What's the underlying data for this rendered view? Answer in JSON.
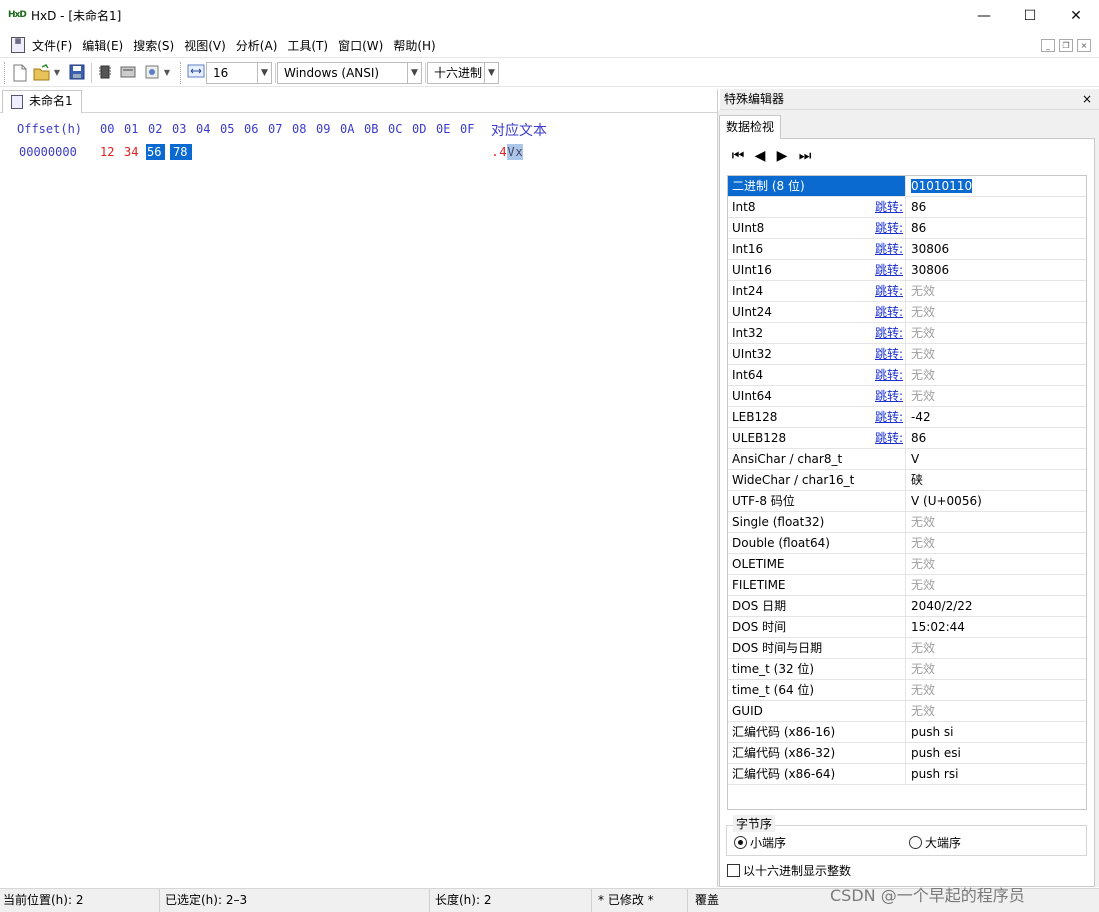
{
  "window": {
    "app_icon_text": "HxD",
    "title": "HxD - [未命名1]",
    "minimize": "—",
    "maximize": "☐",
    "close": "✕"
  },
  "menu": {
    "items": [
      "文件(F)",
      "编辑(E)",
      "搜索(S)",
      "视图(V)",
      "分析(A)",
      "工具(T)",
      "窗口(W)",
      "帮助(H)"
    ],
    "mdi_minimize": "_",
    "mdi_restore": "❐",
    "mdi_close": "×"
  },
  "toolbar": {
    "bytes_per_row": "16",
    "charset": "Windows (ANSI)",
    "offset_base": "十六进制",
    "icons": [
      "new-file-icon",
      "open-file-icon",
      "save-icon",
      "chip-icon",
      "disk-icon",
      "ram-icon",
      "width-icon"
    ]
  },
  "document": {
    "tab_label": "未命名1",
    "offset_header": "Offset(h)",
    "columns": [
      "00",
      "01",
      "02",
      "03",
      "04",
      "05",
      "06",
      "07",
      "08",
      "09",
      "0A",
      "0B",
      "0C",
      "0D",
      "0E",
      "0F"
    ],
    "text_header": "对应文本",
    "row_offset": "00000000",
    "bytes": [
      "12",
      "34",
      "56",
      "78"
    ],
    "selected_bytes": [
      2,
      3
    ],
    "ascii": [
      ".",
      "4",
      "V",
      "x"
    ]
  },
  "inspector": {
    "panel_title": "特殊编辑器",
    "close": "×",
    "tab_label": "数据检视",
    "nav": [
      "⏮",
      "◀",
      "▶",
      "⏭"
    ],
    "jump_label": "跳转:",
    "rows": [
      {
        "name": "二进制 (8 位)",
        "value": "01010110",
        "jump": false,
        "invalid": false,
        "selected": true
      },
      {
        "name": "Int8",
        "value": "86",
        "jump": true,
        "invalid": false
      },
      {
        "name": "UInt8",
        "value": "86",
        "jump": true,
        "invalid": false
      },
      {
        "name": "Int16",
        "value": "30806",
        "jump": true,
        "invalid": false
      },
      {
        "name": "UInt16",
        "value": "30806",
        "jump": true,
        "invalid": false
      },
      {
        "name": "Int24",
        "value": "无效",
        "jump": true,
        "invalid": true
      },
      {
        "name": "UInt24",
        "value": "无效",
        "jump": true,
        "invalid": true
      },
      {
        "name": "Int32",
        "value": "无效",
        "jump": true,
        "invalid": true
      },
      {
        "name": "UInt32",
        "value": "无效",
        "jump": true,
        "invalid": true
      },
      {
        "name": "Int64",
        "value": "无效",
        "jump": true,
        "invalid": true
      },
      {
        "name": "UInt64",
        "value": "无效",
        "jump": true,
        "invalid": true
      },
      {
        "name": "LEB128",
        "value": "-42",
        "jump": true,
        "invalid": false
      },
      {
        "name": "ULEB128",
        "value": "86",
        "jump": true,
        "invalid": false
      },
      {
        "name": "AnsiChar / char8_t",
        "value": "V",
        "jump": false,
        "invalid": false
      },
      {
        "name": "WideChar / char16_t",
        "value": "硖",
        "jump": false,
        "invalid": false
      },
      {
        "name": "UTF-8 码位",
        "value": "V (U+0056)",
        "jump": false,
        "invalid": false
      },
      {
        "name": "Single (float32)",
        "value": "无效",
        "jump": false,
        "invalid": true
      },
      {
        "name": "Double (float64)",
        "value": "无效",
        "jump": false,
        "invalid": true
      },
      {
        "name": "OLETIME",
        "value": "无效",
        "jump": false,
        "invalid": true
      },
      {
        "name": "FILETIME",
        "value": "无效",
        "jump": false,
        "invalid": true
      },
      {
        "name": "DOS 日期",
        "value": "2040/2/22",
        "jump": false,
        "invalid": false
      },
      {
        "name": "DOS 时间",
        "value": "15:02:44",
        "jump": false,
        "invalid": false
      },
      {
        "name": "DOS 时间与日期",
        "value": "无效",
        "jump": false,
        "invalid": true
      },
      {
        "name": "time_t (32 位)",
        "value": "无效",
        "jump": false,
        "invalid": true
      },
      {
        "name": "time_t (64 位)",
        "value": "无效",
        "jump": false,
        "invalid": true
      },
      {
        "name": "GUID",
        "value": "无效",
        "jump": false,
        "invalid": true
      },
      {
        "name": "汇编代码 (x86-16)",
        "value": "push si",
        "jump": false,
        "invalid": false
      },
      {
        "name": "汇编代码 (x86-32)",
        "value": "push esi",
        "jump": false,
        "invalid": false
      },
      {
        "name": "汇编代码 (x86-64)",
        "value": "push rsi",
        "jump": false,
        "invalid": false
      }
    ],
    "byte_order_label": "字节序",
    "little_endian": "小端序",
    "big_endian": "大端序",
    "byte_order_selected": "little",
    "hex_int_label": "以十六进制显示整数",
    "hex_int_checked": false
  },
  "status": {
    "position": "当前位置(h): 2",
    "selection": "已选定(h): 2–3",
    "length": "长度(h): 2",
    "modified": "* 已修改 *",
    "mode": "覆盖"
  },
  "watermark": "CSDN @一个早起的程序员",
  "colors": {
    "offset_blue": "#3b3bc8",
    "byte_red": "#e02020",
    "selection_blue": "#0a6ad0",
    "link_blue": "#1a2fd0",
    "invalid_gray": "#a0a0a0"
  }
}
